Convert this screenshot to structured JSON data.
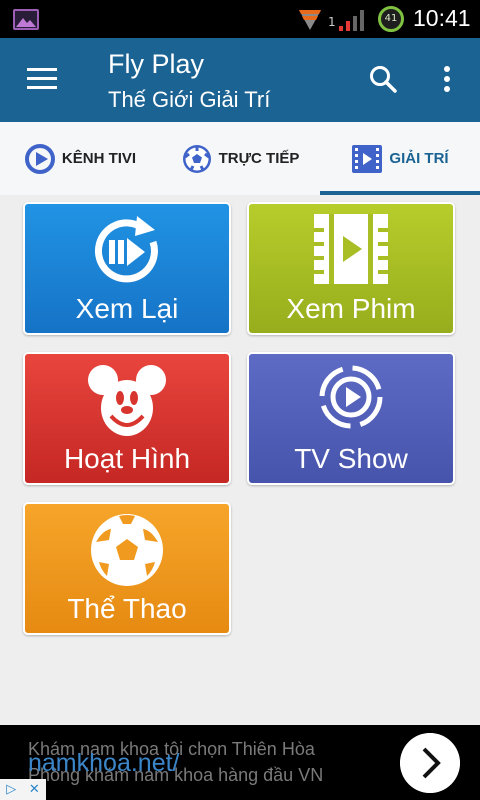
{
  "status_bar": {
    "sim_label": "1",
    "battery_level": "41",
    "time": "10:41",
    "icons": [
      "gallery-icon",
      "wifi-icon",
      "signal-icon",
      "battery-icon"
    ]
  },
  "app_bar": {
    "title": "Fly Play",
    "subtitle": "Thế Giới Giải Trí",
    "icons": [
      "menu-icon",
      "search-icon",
      "more-vert-icon"
    ]
  },
  "tabs": [
    {
      "label": "KÊNH TIVI",
      "icon": "play-circle-icon",
      "active": false
    },
    {
      "label": "TRỰC TIẾP",
      "icon": "soccer-ball-icon",
      "active": false
    },
    {
      "label": "GIẢI TRÍ",
      "icon": "film-strip-icon",
      "active": true
    }
  ],
  "tiles": [
    {
      "label": "Xem Lại",
      "icon": "replay-icon",
      "color": "#1a82d6"
    },
    {
      "label": "Xem Phim",
      "icon": "film-play-icon",
      "color": "#a8be24"
    },
    {
      "label": "Hoạt Hình",
      "icon": "mickey-mouse-icon",
      "color": "#d9352f"
    },
    {
      "label": "TV Show",
      "icon": "tv-show-play-icon",
      "color": "#5260b8"
    },
    {
      "label": "Thể Thao",
      "icon": "soccer-ball-icon",
      "color": "#f09a1f"
    }
  ],
  "ad": {
    "line1": "Khám nam khoa tôi chọn Thiên Hòa",
    "line2": "Phòng khám nam khoa hàng đầu VN",
    "url": "namkhoa.net/",
    "info_left": "▷",
    "info_right": "✕"
  },
  "colors": {
    "app_bar": "#1b6393",
    "active_tab": "#1b6393",
    "background": "#eeeeee"
  }
}
